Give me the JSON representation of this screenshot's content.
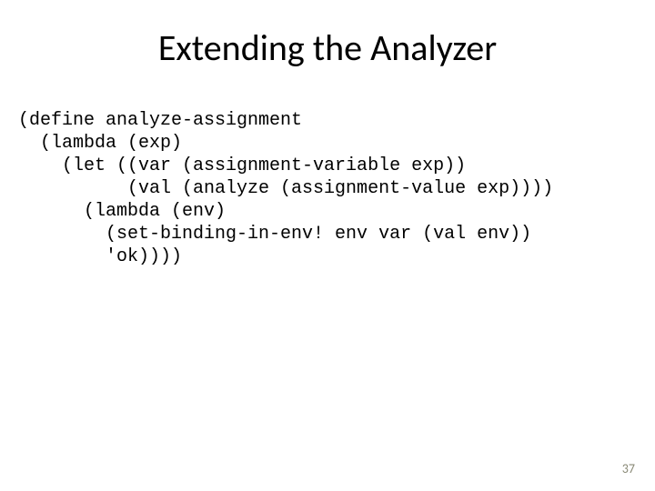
{
  "title": "Extending the Analyzer",
  "code": {
    "l1": "(define analyze-assignment",
    "l2": "  (lambda (exp)",
    "l3": "    (let ((var (assignment-variable exp))",
    "l4": "          (val (analyze (assignment-value exp))))",
    "l5": "      (lambda (env)",
    "l6": "        (set-binding-in-env! env var (val env))",
    "l7": "        'ok))))"
  },
  "page_number": "37"
}
